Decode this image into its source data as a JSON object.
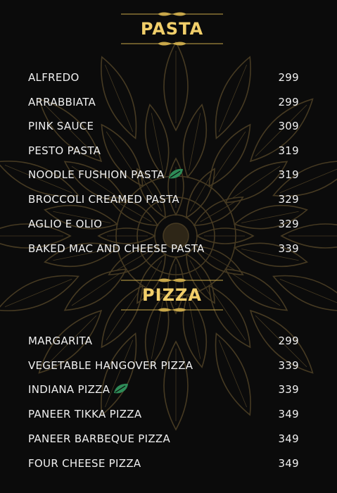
{
  "sections": [
    {
      "title": "PASTA",
      "items": [
        {
          "name": "ALFREDO",
          "price": "299"
        },
        {
          "name": "ARRABBIATA",
          "price": "299"
        },
        {
          "name": "PINK SAUCE",
          "price": "309"
        },
        {
          "name": "PESTO PASTA",
          "price": "319"
        },
        {
          "name": "NOODLE FUSHION PASTA",
          "price": "319",
          "icon": "leaf-icon"
        },
        {
          "name": "BROCCOLI CREAMED PASTA",
          "price": "329"
        },
        {
          "name": "AGLIO E OLIO",
          "price": "329"
        },
        {
          "name": "BAKED MAC AND CHEESE PASTA",
          "price": "339"
        }
      ]
    },
    {
      "title": "PIZZA",
      "items": [
        {
          "name": "MARGARITA",
          "price": "299"
        },
        {
          "name": "VEGETABLE HANGOVER PIZZA",
          "price": "339"
        },
        {
          "name": "INDIANA PIZZA",
          "price": "339",
          "icon": "leaf-icon"
        },
        {
          "name": "PANEER TIKKA PIZZA",
          "price": "349"
        },
        {
          "name": "PANEER BARBEQUE PIZZA",
          "price": "349"
        },
        {
          "name": "FOUR CHEESE PIZZA",
          "price": "349"
        }
      ]
    }
  ],
  "colors": {
    "background": "#0b0b0b",
    "title": "#f2cf6a",
    "text": "#f0f0f0",
    "ornament": "#c9a84a",
    "leaf": "#2e8b57",
    "mandala": "#5a4a2a"
  }
}
